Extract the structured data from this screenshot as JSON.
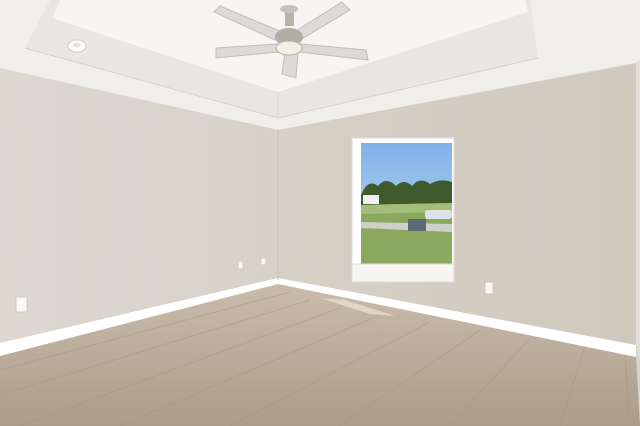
{
  "scene": {
    "description_kind": "empty-room-photo",
    "elements": [
      "tray-ceiling",
      "ceiling-fan",
      "smoke-detector",
      "window",
      "baseboard",
      "outlets",
      "laminate-floor"
    ]
  },
  "colors": {
    "wall_left": "#d9d5ce",
    "wall_right": "#d3cdc3",
    "ceiling": "#f1efec",
    "floor": "#b9ab98",
    "trim": "#ffffff",
    "sky": "#9cc3ec",
    "grass": "#8aa65e",
    "trees": "#3f5a2c"
  }
}
